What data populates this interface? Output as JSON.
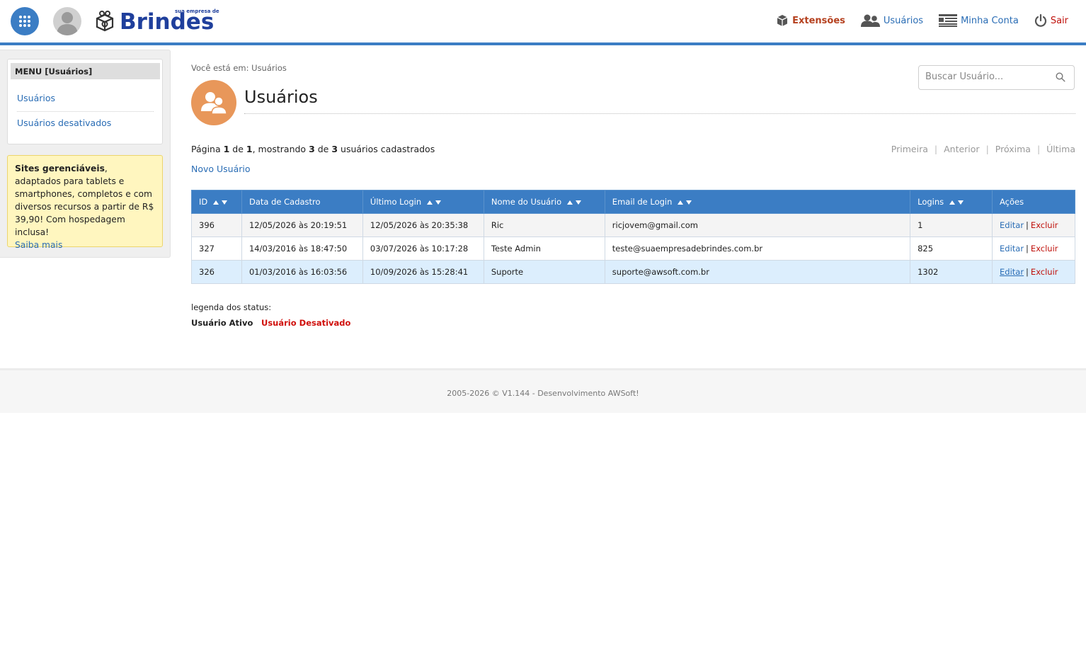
{
  "header": {
    "logo_text": "Brindes",
    "logo_tagline": "sua empresa de",
    "nav": [
      {
        "label": "Extensões",
        "icon": "cube-icon"
      },
      {
        "label": "Usuários",
        "icon": "users-icon"
      },
      {
        "label": "Minha Conta",
        "icon": "account-icon"
      },
      {
        "label": "Sair",
        "icon": "power-icon"
      }
    ]
  },
  "sidebar": {
    "menu_title": "MENU [Usuários]",
    "items": [
      {
        "label": "Usuários"
      },
      {
        "label": "Usuários desativados"
      }
    ],
    "promo": {
      "bold": "Sites gerenciáveis",
      "text": ", adaptados para tablets e smartphones, completos e com diversos recursos a partir de R$ 39,90! Com hospedagem inclusa!",
      "link": "Saiba mais"
    }
  },
  "main": {
    "breadcrumb": "Você está em: Usuários",
    "title": "Usuários",
    "search_placeholder": "Buscar Usuário...",
    "page_info": {
      "p1": "Página ",
      "page": "1",
      "p2": " de ",
      "pages": "1",
      "p3": ", mostrando ",
      "shown": "3",
      "p4": " de ",
      "total": "3",
      "p5": " usuários cadastrados"
    },
    "pager": {
      "first": "Primeira",
      "prev": "Anterior",
      "next": "Próxima",
      "last": "Última",
      "sep": "|"
    },
    "new_user": "Novo Usuário",
    "columns": [
      "ID",
      "Data de Cadastro",
      "Último Login",
      "Nome do Usuário",
      "Email de Login",
      "Logins",
      "Ações"
    ],
    "rows": [
      {
        "id": "396",
        "created": "12/05/2026 às 20:19:51",
        "last_login": "12/05/2026 às 20:35:38",
        "name": "Ric",
        "email": "ricjovem@gmail.com",
        "logins": "1"
      },
      {
        "id": "327",
        "created": "14/03/2016 às 18:47:50",
        "last_login": "03/07/2026 às 10:17:28",
        "name": "Teste Admin",
        "email": "teste@suaempresadebrindes.com.br",
        "logins": "825"
      },
      {
        "id": "326",
        "created": "01/03/2016 às 16:03:56",
        "last_login": "10/09/2026 às 15:28:41",
        "name": "Suporte",
        "email": "suporte@awsoft.com.br",
        "logins": "1302"
      }
    ],
    "actions": {
      "edit": "Editar",
      "sep": "|",
      "delete": "Excluir"
    },
    "legend": {
      "label": "legenda dos status:",
      "active": "Usuário Ativo",
      "inactive": "Usuário Desativado"
    }
  },
  "footer": {
    "text": "2005-2026 © V1.144 - Desenvolvimento AWSoft!"
  },
  "colors": {
    "primary": "#3b7dc4",
    "link": "#2a6db5",
    "danger": "#c0120c",
    "accent": "#e8975a"
  }
}
